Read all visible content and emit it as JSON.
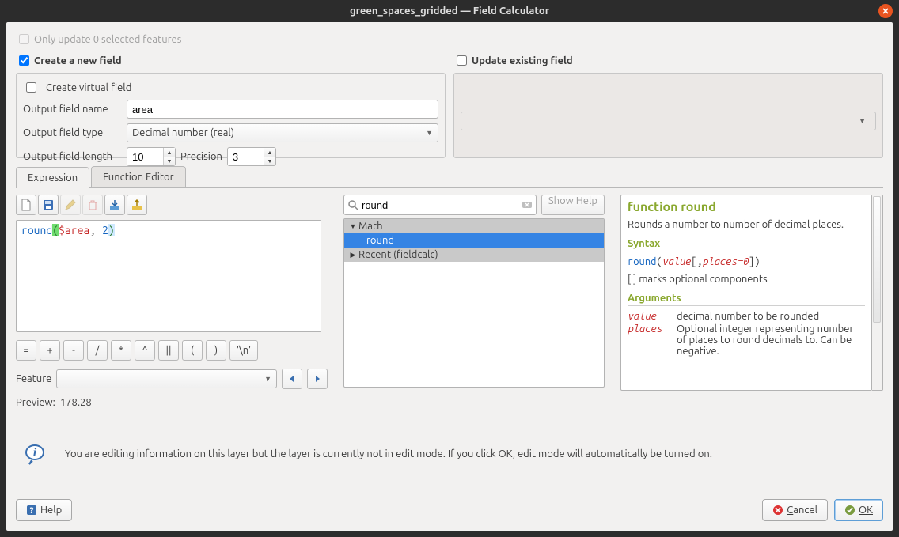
{
  "window": {
    "title": "green_spaces_gridded — Field Calculator"
  },
  "top": {
    "only_update_label": "Only update 0 selected features",
    "create_field_label": "Create a new field",
    "update_field_label": "Update existing field"
  },
  "create": {
    "virtual_label": "Create virtual field",
    "name_label": "Output field name",
    "name_value": "area",
    "type_label": "Output field type",
    "type_value": "Decimal number (real)",
    "length_label": "Output field length",
    "length_value": "10",
    "precision_label": "Precision",
    "precision_value": "3"
  },
  "tabs": {
    "expression": "Expression",
    "function_editor": "Function Editor"
  },
  "toolbar": {
    "new": "new",
    "save": "save",
    "edit": "edit",
    "clear": "clear",
    "import": "import",
    "export": "export"
  },
  "expression": {
    "tokens": {
      "fn": "round",
      "var": "$area",
      "num": "2"
    },
    "ops": [
      "=",
      "+",
      "-",
      "/",
      "*",
      "^",
      "||",
      "(",
      ")",
      "'\\n'"
    ],
    "feature_label": "Feature",
    "preview_label": "Preview:",
    "preview_value": "178.28"
  },
  "search": {
    "value": "round",
    "show_help": "Show Help"
  },
  "tree": {
    "group_math": "Math",
    "item_round": "round",
    "group_recent": "Recent (fieldcalc)"
  },
  "help": {
    "title": "function round",
    "desc": "Rounds a number to number of decimal places.",
    "syntax_label": "Syntax",
    "syntax_fn": "round",
    "syntax_arg1": "value",
    "syntax_arg2": "places=0",
    "optional_note": "[ ] marks optional components",
    "args_label": "Arguments",
    "args": [
      {
        "name": "value",
        "desc": "decimal number to be rounded"
      },
      {
        "name": "places",
        "desc": "Optional integer representing number of places to round decimals to. Can be negative."
      }
    ]
  },
  "info": {
    "text": "You are editing information on this layer but the layer is currently not in edit mode. If you click OK, edit mode will automatically be turned on."
  },
  "buttons": {
    "help": "Help",
    "cancel": "Cancel",
    "ok": "OK"
  }
}
